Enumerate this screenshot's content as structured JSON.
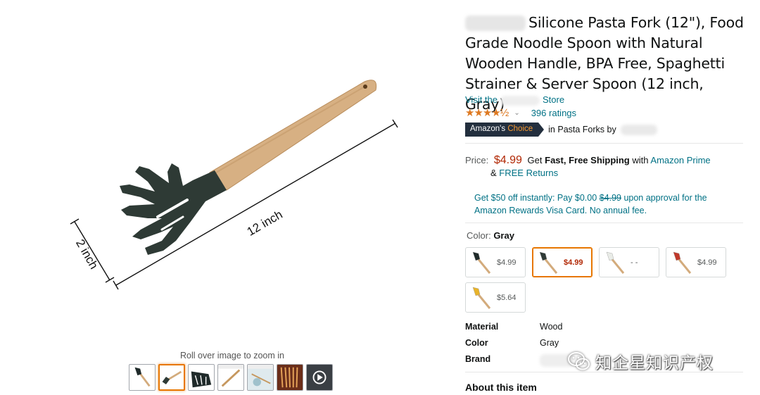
{
  "gallery": {
    "zoom_hint": "Roll over image to zoom in",
    "dimension_length": "12 inch",
    "dimension_width": "2 inch",
    "thumbnail_count": 7,
    "selected_thumbnail": 2
  },
  "product": {
    "title": "Silicone Pasta Fork (12\"), Food Grade Noodle Spoon with Natural Wooden Handle, BPA Free, Spaghetti Strainer & Server Spoon (12 inch, Gray)",
    "visit_prefix": "Visit the",
    "visit_suffix": "Store",
    "rating_stars": "★★★★½",
    "rating_value": 4.5,
    "ratings_count": "396 ratings",
    "choice_badge_prefix": "Amazon's",
    "choice_badge_highlight": "Choice",
    "choice_text": "in Pasta Forks by"
  },
  "price": {
    "label": "Price:",
    "amount": "$4.99",
    "shipping_get": "Get",
    "shipping_fast": "Fast, Free Shipping",
    "shipping_with": "with",
    "prime_link": "Amazon Prime",
    "returns_amp": "&",
    "returns_link": "FREE Returns",
    "visa_offer_1": "Get $50 off instantly: Pay $0.00",
    "visa_strike": "$4.99",
    "visa_offer_2": "upon approval for the Amazon Rewards Visa Card. No annual fee."
  },
  "color": {
    "label": "Color:",
    "selected": "Gray",
    "options": [
      {
        "price": "$4.99",
        "head": "#1f2a2a",
        "handle": "#d3ab7c"
      },
      {
        "price": "$4.99",
        "head": "#2f3a36",
        "handle": "#d3ab7c"
      },
      {
        "price": "- -",
        "head": "#e9ece7",
        "handle": "#d3ab7c"
      },
      {
        "price": "$4.99",
        "head": "#c0392b",
        "handle": "#d3ab7c"
      },
      {
        "price": "$5.64",
        "head": "#e8b32a",
        "handle": "#d3ab7c"
      }
    ]
  },
  "attributes": [
    {
      "key": "Material",
      "value": "Wood"
    },
    {
      "key": "Color",
      "value": "Gray"
    },
    {
      "key": "Brand",
      "value": ""
    }
  ],
  "about_heading": "About this item",
  "watermark": "知企星知识产权",
  "colors": {
    "link": "#007185",
    "price": "#b12704",
    "star": "#de7921",
    "badge": "#232f3e",
    "selected_border": "#e77600"
  }
}
